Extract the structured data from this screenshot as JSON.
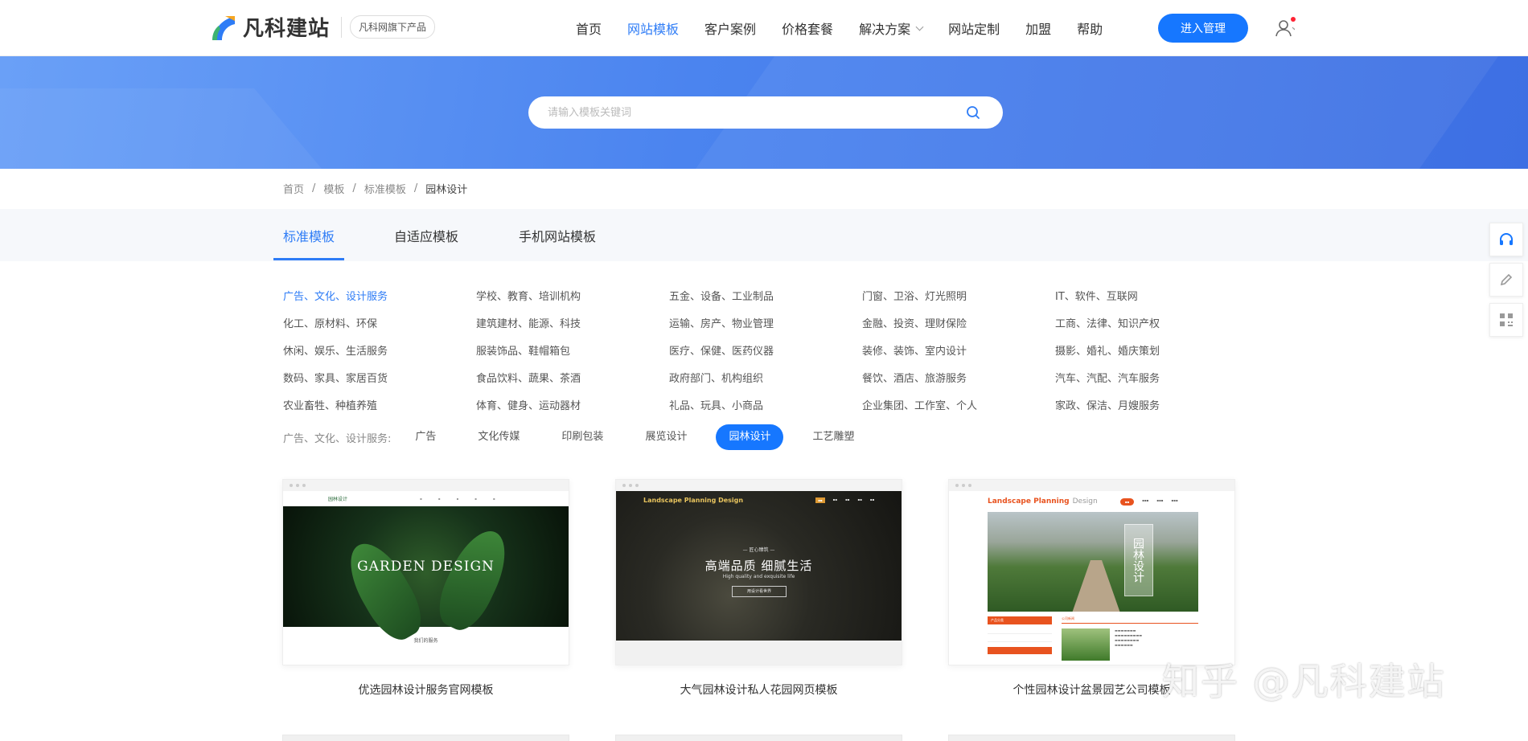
{
  "header": {
    "logo_text": "凡科建站",
    "logo_badge": "凡科网旗下产品",
    "nav": [
      {
        "label": "首页",
        "active": false
      },
      {
        "label": "网站模板",
        "active": true
      },
      {
        "label": "客户案例",
        "active": false
      },
      {
        "label": "价格套餐",
        "active": false
      },
      {
        "label": "解决方案",
        "active": false,
        "dropdown": true
      },
      {
        "label": "网站定制",
        "active": false
      },
      {
        "label": "加盟",
        "active": false
      },
      {
        "label": "帮助",
        "active": false
      }
    ],
    "admin_button": "进入管理",
    "user_icon": "user-icon"
  },
  "search": {
    "placeholder": "请输入模板关键词",
    "icon": "search-icon"
  },
  "breadcrumb": [
    "首页",
    "模板",
    "标准模板",
    "园林设计"
  ],
  "tabs": [
    {
      "label": "标准模板",
      "active": true
    },
    {
      "label": "自适应模板",
      "active": false
    },
    {
      "label": "手机网站模板",
      "active": false
    }
  ],
  "categories": [
    [
      "广告、文化、设计服务",
      "学校、教育、培训机构",
      "五金、设备、工业制品",
      "门窗、卫浴、灯光照明",
      "IT、软件、互联网"
    ],
    [
      "化工、原材料、环保",
      "建筑建材、能源、科技",
      "运输、房产、物业管理",
      "金融、投资、理财保险",
      "工商、法律、知识产权"
    ],
    [
      "休闲、娱乐、生活服务",
      "服装饰品、鞋帽箱包",
      "医疗、保健、医药仪器",
      "装修、装饰、室内设计",
      "摄影、婚礼、婚庆策划"
    ],
    [
      "数码、家具、家居百货",
      "食品饮料、蔬果、茶酒",
      "政府部门、机构组织",
      "餐饮、酒店、旅游服务",
      "汽车、汽配、汽车服务"
    ],
    [
      "农业畜牲、种植养殖",
      "体育、健身、运动器材",
      "礼品、玩具、小商品",
      "企业集团、工作室、个人",
      "家政、保洁、月嫂服务"
    ]
  ],
  "active_category": "广告、文化、设计服务",
  "subcategories": {
    "label": "广告、文化、设计服务:",
    "items": [
      {
        "label": "广告",
        "active": false
      },
      {
        "label": "文化传媒",
        "active": false
      },
      {
        "label": "印刷包装",
        "active": false
      },
      {
        "label": "展览设计",
        "active": false
      },
      {
        "label": "园林设计",
        "active": true
      },
      {
        "label": "工艺雕塑",
        "active": false
      }
    ]
  },
  "templates": [
    {
      "title": "优选园林设计服务官网模板",
      "preview": {
        "brand": "园林设计",
        "heading": "GARDEN DESIGN",
        "footer": "我们的服务"
      }
    },
    {
      "title": "大气园林设计私人花园网页模板",
      "preview": {
        "brand": "Landscape Planning Design",
        "kicker": "— 匠心臻筑 —",
        "heading": "高端品质  细腻生活",
        "sub": "High quality and exquisite life",
        "button": "用设计看世界"
      }
    },
    {
      "title": "个性园林设计盆景园艺公司模板",
      "preview": {
        "brand_a": "Landscape Planning",
        "brand_b": "Design",
        "overlay": "园林设计",
        "side_heading": "产品分类",
        "news_heading": "公司新闻"
      }
    }
  ],
  "side_tools": [
    "headset-icon",
    "pencil-icon",
    "qrcode-icon"
  ],
  "watermark": "知乎 @凡科建站",
  "colors": {
    "accent": "#1677ff",
    "active_text": "#2e7cf6",
    "preview_orange": "#e8531f"
  }
}
